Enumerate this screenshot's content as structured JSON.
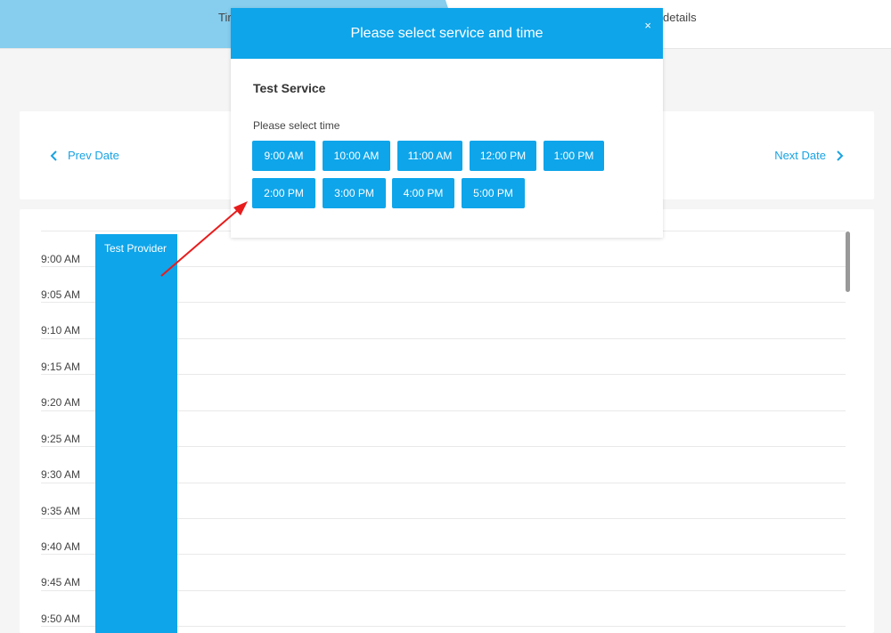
{
  "steps": {
    "left_label": "Tir",
    "right_label": "details"
  },
  "date_nav": {
    "prev_label": "Prev Date",
    "next_label": "Next Date"
  },
  "schedule": {
    "provider": "Test Provider",
    "times": [
      "9:00 AM",
      "9:05 AM",
      "9:10 AM",
      "9:15 AM",
      "9:20 AM",
      "9:25 AM",
      "9:30 AM",
      "9:35 AM",
      "9:40 AM",
      "9:45 AM",
      "9:50 AM"
    ]
  },
  "modal": {
    "title": "Please select service and time",
    "close": "×",
    "service_name": "Test Service",
    "select_time_label": "Please select time",
    "time_slots": [
      "9:00 AM",
      "10:00 AM",
      "11:00 AM",
      "12:00 PM",
      "1:00 PM",
      "2:00 PM",
      "3:00 PM",
      "4:00 PM",
      "5:00 PM"
    ]
  },
  "colors": {
    "accent": "#0ea5ea",
    "step_active": "#86cdee",
    "annotation_arrow": "#e81c1c"
  }
}
